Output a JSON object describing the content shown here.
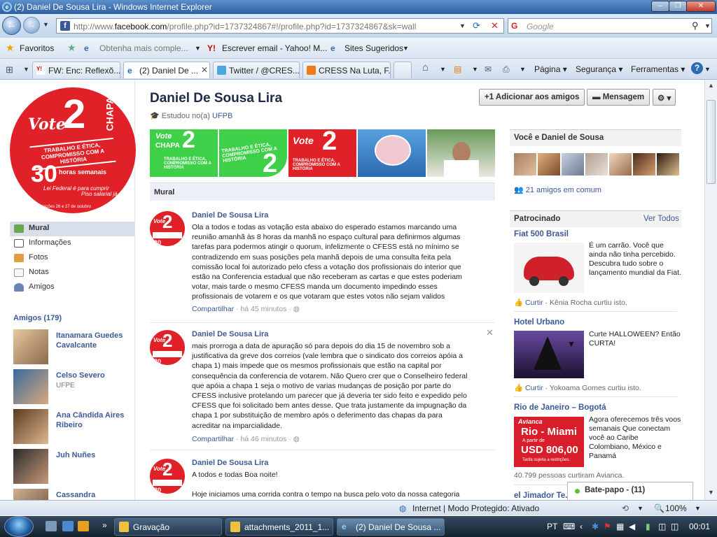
{
  "window": {
    "title": "(2) Daniel De Sousa Lira - Windows Internet Explorer"
  },
  "address": {
    "prefix": "http://www.",
    "host": "facebook.com",
    "rest": "/profile.php?id=1737324867#!/profile.php?id=1737324867&sk=wall"
  },
  "search": {
    "placeholder": "Google"
  },
  "favorites": {
    "label": "Favoritos",
    "items": [
      "Obtenha mais comple...",
      "Escrever email - Yahoo! M...",
      "Sites Sugeridos"
    ]
  },
  "tabs": [
    {
      "label": "FW: Enc: Reflexõ..."
    },
    {
      "label": "(2) Daniel De ..."
    },
    {
      "label": "Twitter / @CRES..."
    },
    {
      "label": "CRESS Na Luta, F..."
    }
  ],
  "commands": {
    "page": "Página",
    "security": "Segurança",
    "tools": "Ferramentas"
  },
  "profile": {
    "name": "Daniel De Sousa Lira",
    "studied_prefix": "Estudou no(a)",
    "studied_school": "UFPB",
    "add_friend": "Adicionar aos amigos",
    "message": "Mensagem"
  },
  "vote_logo": {
    "vote": "Vote",
    "number": "2",
    "chapa": "CHAPA",
    "slogan": "TRABALHO E ÉTICA, COMPROMISSO COM A HISTÓRIA",
    "hours": "30",
    "hours_text": "horas semanais",
    "law": "Lei Federal é para cumprir",
    "piso": "Piso salarial já",
    "election": "eleições 26 e 27 de outubro"
  },
  "left_nav": [
    {
      "label": "Mural"
    },
    {
      "label": "Informações"
    },
    {
      "label": "Fotos"
    },
    {
      "label": "Notas"
    },
    {
      "label": "Amigos"
    }
  ],
  "friends": {
    "header": "Amigos (179)",
    "list": [
      {
        "name": "Itanamara Guedes Cavalcante",
        "sub": ""
      },
      {
        "name": "Celso Severo",
        "sub": "UFPE"
      },
      {
        "name": "Ana Cândida Aires Ribeiro",
        "sub": ""
      },
      {
        "name": "Juh Nuñes",
        "sub": ""
      },
      {
        "name": "Cassandra",
        "sub": ""
      }
    ]
  },
  "wall": {
    "header": "Mural",
    "share": "Compartilhar",
    "posts": [
      {
        "author": "Daniel De Sousa Lira",
        "text": "Ola a todos e todas as votação esta abaixo do esperado estamos marcando uma reunião amanhã às 8 horas da manhã no espaço cultural para definirmos algumas tarefas para podermos atingir o quorum, infelizmente o CFESS está no mínimo se contradizendo em suas posições pela manhã depois de uma consulta feita pela comissão local foi autorizado pelo cfess a votação dos profissionais do interior que estão na Conferencia estadual que não receberam as cartas e que estes poderiam votar, mais tarde o mesmo CFESS manda um documento impedindo esses profissionais de votarem e os que votaram que estes votos não sejam validos",
        "time": "há 45 minutos"
      },
      {
        "author": "Daniel De Sousa Lira",
        "text": "mais prorroga a data de apuração só para depois do dia 15 de novembro sob a justificativa da greve dos correios (vale lembra que o sindicato dos correios apóia a chapa 1) mais impede que os mesmos profissionais que estão na capital por consequência da conferencia de votarem. Não Quero crer que o Conselheiro federal que apóia a chapa 1 seja o motivo de varias mudanças de posição por parte do CFESS inclusive protelando um parecer que já deveria ter sido feito e expedido pelo CFESS que foi solicitado bem antes desse. Que trata justamente da impugnação da chapa 1 por substituição de membro após o deferimento das chapas da para acreditar na imparcialidade.",
        "time": "há 46 minutos"
      },
      {
        "author": "Daniel De Sousa Lira",
        "text": "A todos e todas Boa noite!",
        "text2": "Hoje iniciamos uma corrida contra o tempo na busca pelo voto da nossa categoria",
        "time": ""
      }
    ]
  },
  "right": {
    "mutual_header": "Você e Daniel de Sousa",
    "mutual_count": "21 amigos em comum",
    "sponsored": "Patrocinado",
    "see_all": "Ver Todos",
    "like": "Curtir",
    "ads": [
      {
        "title": "Fiat 500 Brasil",
        "desc": "É um carrão. Você que ainda não tinha percebido. Descubra tudo sobre o lançamento mundial da Fiat.",
        "liked": "Kênia Rocha curtiu isto."
      },
      {
        "title": "Hotel Urbano",
        "desc": "Curte HALLOWEEN? Então CURTA!",
        "liked": "Yokoama Gomes curtiu isto."
      },
      {
        "title": "Rio de Janeiro – Bogotá",
        "desc": "Agora oferecemos três voos semanais Que conectam você ao Caribe Colombiano, México e Panamá",
        "liked": "40.799 pessoas curtiram Avianca.",
        "img_brand": "Avianca",
        "img_route": "Rio - Miami",
        "img_from": "A partir de",
        "img_price": "USD 806,00",
        "img_note": "Tarifa sujeita a restrições."
      },
      {
        "title": "el Jimador Te..."
      }
    ]
  },
  "chat": {
    "label": "Bate-papo - (11)"
  },
  "statusbar": {
    "zone": "Internet | Modo Protegido: Ativado",
    "zoom": "100%"
  },
  "taskbar": {
    "items": [
      {
        "label": "Gravação"
      },
      {
        "label": "attachments_2011_1..."
      },
      {
        "label": "(2) Daniel De Sousa ..."
      }
    ],
    "lang": "PT",
    "clock": "00:01"
  }
}
